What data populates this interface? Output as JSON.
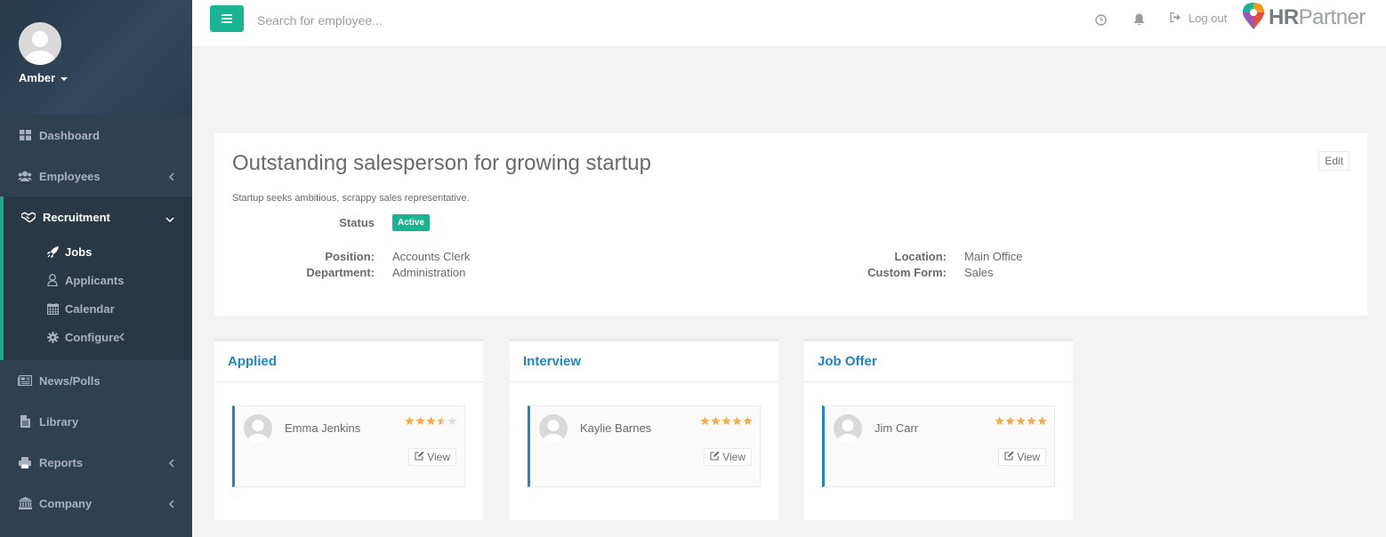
{
  "user": {
    "name": "Amber"
  },
  "sidebar": {
    "items": [
      {
        "label": "Dashboard",
        "icon": "dashboard-icon"
      },
      {
        "label": "Employees",
        "icon": "users-icon"
      },
      {
        "label": "Recruitment",
        "icon": "handshake-icon"
      },
      {
        "label": "News/Polls",
        "icon": "newspaper-icon"
      },
      {
        "label": "Library",
        "icon": "file-icon"
      },
      {
        "label": "Reports",
        "icon": "print-icon"
      },
      {
        "label": "Company",
        "icon": "bank-icon"
      }
    ],
    "sub_items": [
      {
        "label": "Jobs",
        "icon": "rocket-icon"
      },
      {
        "label": "Applicants",
        "icon": "user-icon"
      },
      {
        "label": "Calendar",
        "icon": "calendar-icon"
      },
      {
        "label": "Configure",
        "icon": "gear-icon"
      }
    ],
    "accent_color": "#19aa8d"
  },
  "topbar": {
    "search_placeholder": "Search for employee...",
    "logout_label": "Log out",
    "brand_prefix": "HR",
    "brand_suffix": "Partner"
  },
  "job": {
    "title": "Outstanding salesperson for growing startup",
    "edit_label": "Edit",
    "description": "Startup seeks ambitious, scrappy sales representative.",
    "status_label": "Status",
    "status_value": "Active",
    "position_label": "Position:",
    "position_value": "Accounts Clerk",
    "department_label": "Department:",
    "department_value": "Administration",
    "location_label": "Location:",
    "location_value": "Main Office",
    "custom_form_label": "Custom Form:",
    "custom_form_value": "Sales"
  },
  "stages": [
    {
      "title": "Applied",
      "applicants": [
        {
          "name": "Emma Jenkins",
          "rating": 3.5,
          "view_label": "View"
        }
      ]
    },
    {
      "title": "Interview",
      "applicants": [
        {
          "name": "Kaylie Barnes",
          "rating": 5,
          "view_label": "View"
        }
      ]
    },
    {
      "title": "Job Offer",
      "applicants": [
        {
          "name": "Jim Carr",
          "rating": 5,
          "view_label": "View"
        }
      ]
    }
  ],
  "colors": {
    "primary": "#1ab394",
    "link": "#2185c5",
    "star": "#f0ad4e"
  }
}
